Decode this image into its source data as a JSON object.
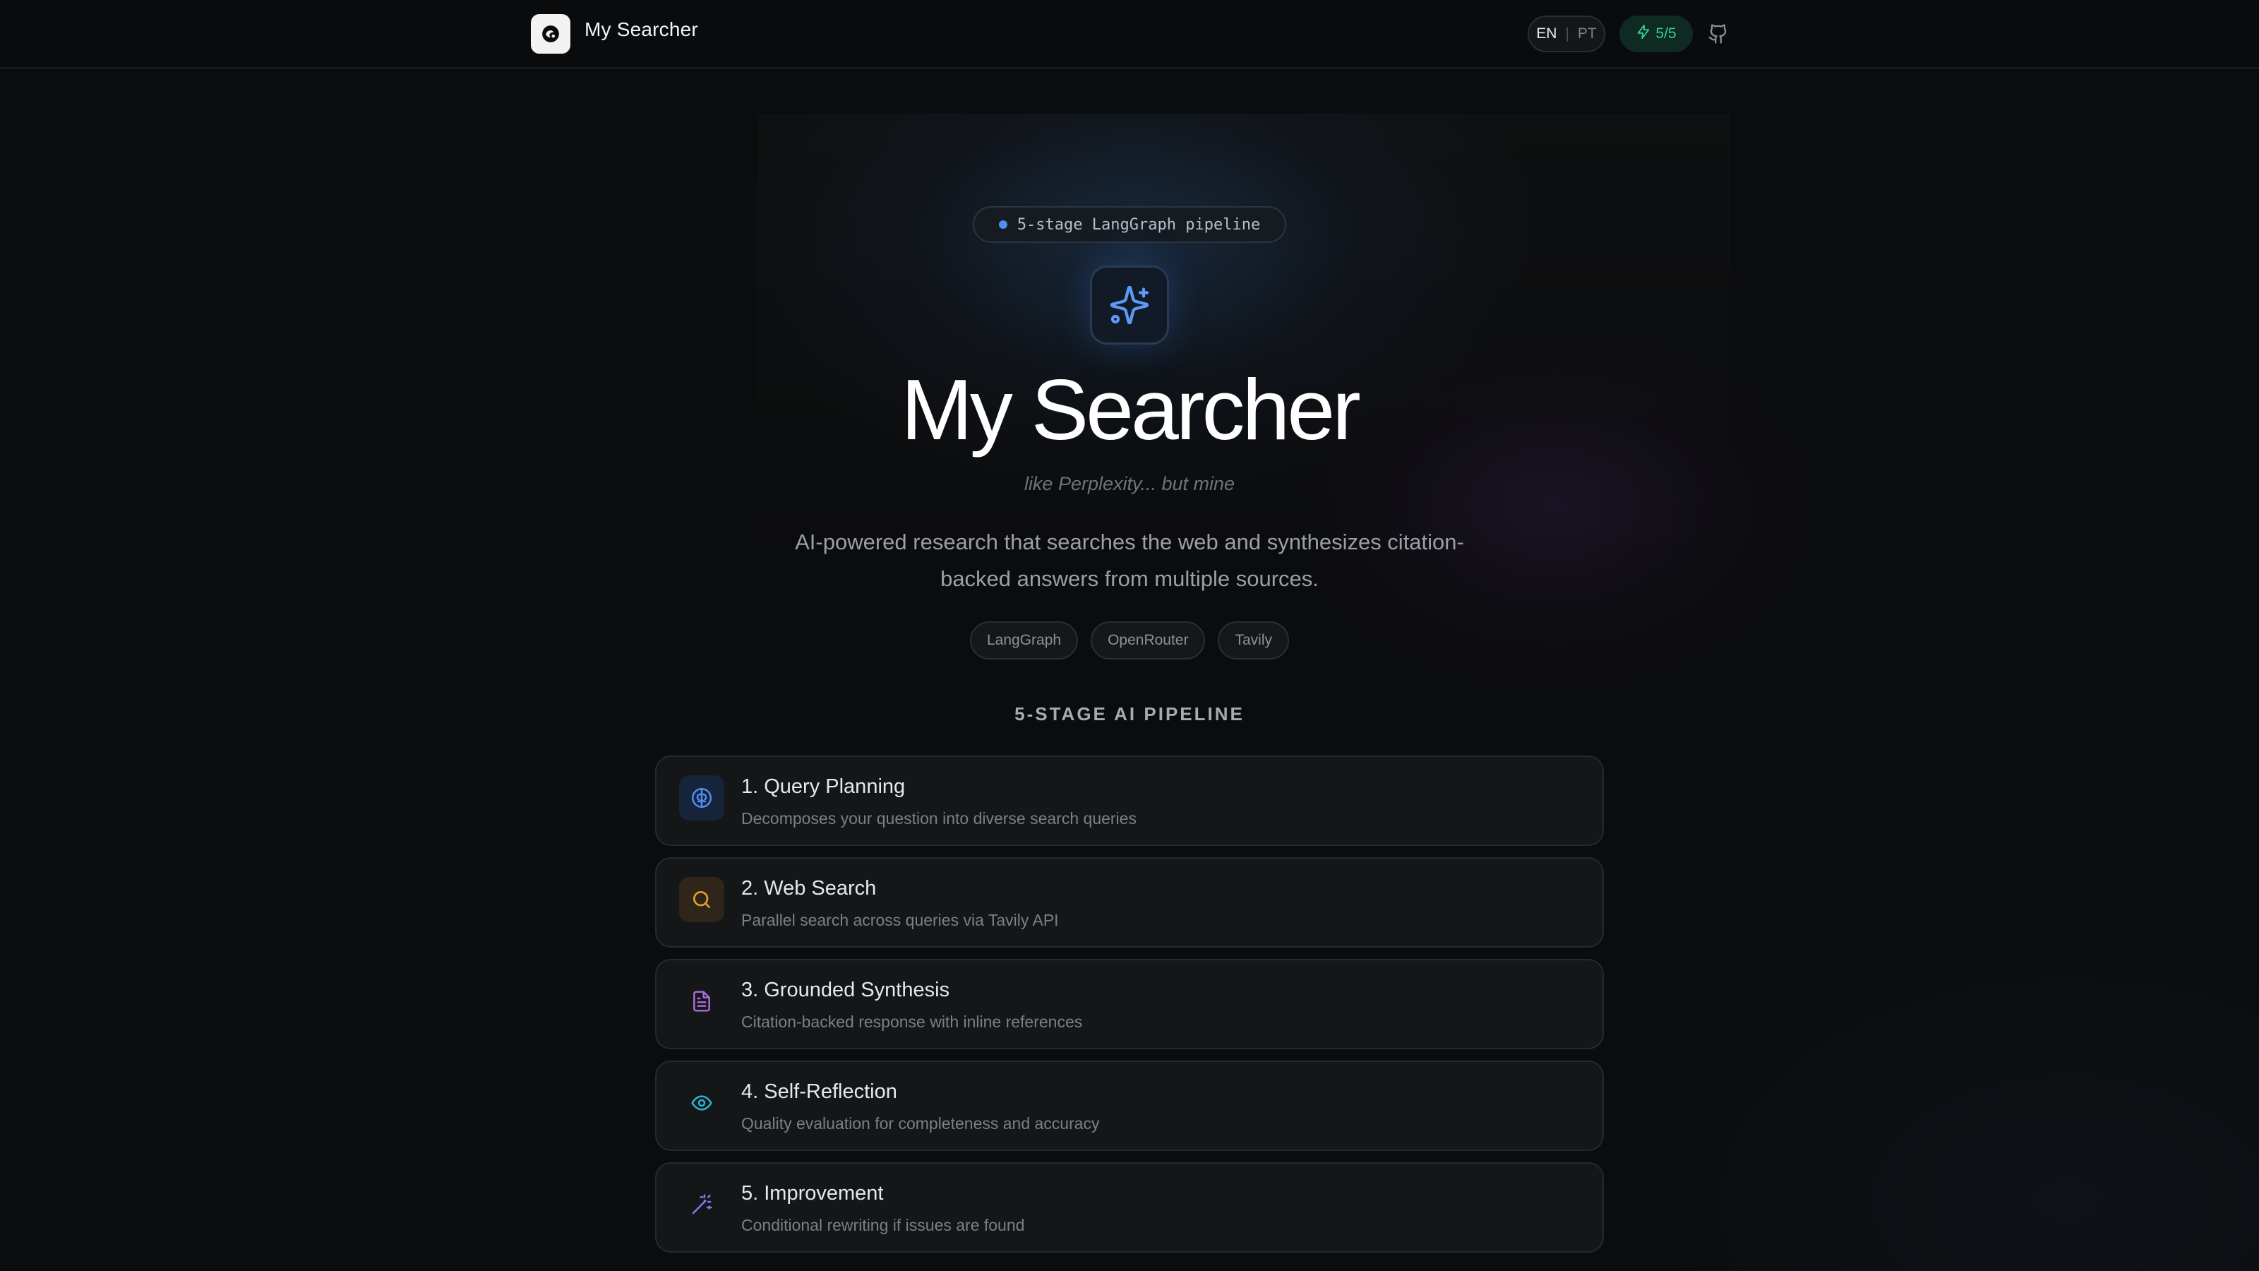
{
  "header": {
    "brand": "My Searcher",
    "lang_en": "EN",
    "lang_sep": "|",
    "lang_pt": "PT",
    "usage": "5/5",
    "logo_icon": "app-logo-icon",
    "github_icon": "github-icon"
  },
  "hero": {
    "pill": "5-stage LangGraph pipeline",
    "icon": "sparkles-icon",
    "title": "My Searcher",
    "tagline": "like Perplexity... but mine",
    "description": "AI-powered research that searches the web and synthesizes citation-backed answers from multiple sources.",
    "tags": [
      "LangGraph",
      "OpenRouter",
      "Tavily"
    ]
  },
  "pipeline": {
    "title": "5-STAGE AI PIPELINE",
    "stages": [
      {
        "title": "1. Query Planning",
        "subtitle": "Decomposes your question into diverse search queries",
        "icon": "brain-icon",
        "color": "#4d8ff0"
      },
      {
        "title": "2. Web Search",
        "subtitle": "Parallel search across queries via Tavily API",
        "icon": "search-icon",
        "color": "#e0a227"
      },
      {
        "title": "3. Grounded Synthesis",
        "subtitle": "Citation-backed response with inline references",
        "icon": "document-icon",
        "color": "#b06ee0"
      },
      {
        "title": "4. Self-Reflection",
        "subtitle": "Quality evaluation for completeness and accuracy",
        "icon": "eye-icon",
        "color": "#22b8cf"
      },
      {
        "title": "5. Improvement",
        "subtitle": "Conditional rewriting if issues are found",
        "icon": "magic-wand-icon",
        "color": "#7c7cf0"
      }
    ]
  },
  "colors": {
    "background": "#0b0c0d",
    "accent_blue": "#4d8ff0",
    "usage_green": "#3bd08f"
  }
}
